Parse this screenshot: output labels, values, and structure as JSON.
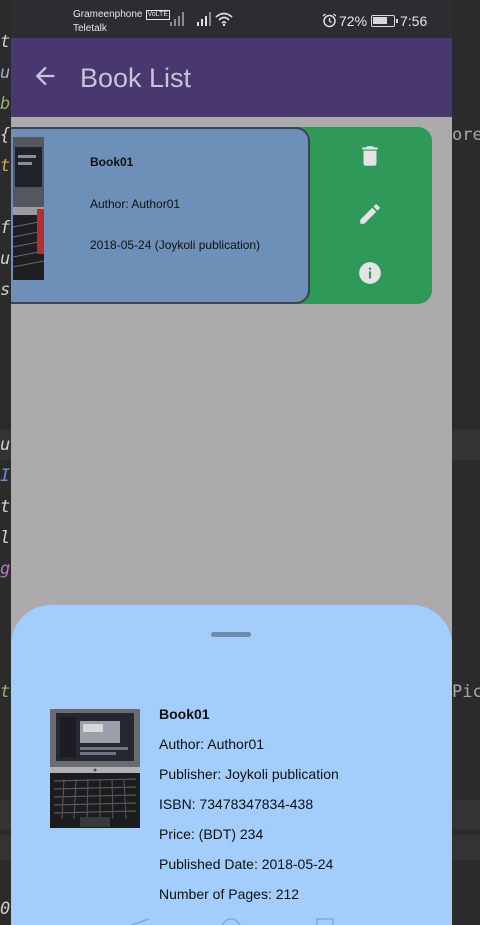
{
  "ide": {
    "left_chars": [
      "t",
      "u",
      "b",
      "{",
      "t",
      "f",
      "u",
      "s",
      "u",
      "I",
      "t",
      "l",
      "g",
      "t",
      "0"
    ],
    "right_words": [
      "ore",
      "Pic"
    ]
  },
  "status_bar": {
    "carrier1": "Grameenphone",
    "volte": "VoLTE",
    "carrier2": "Teletalk",
    "battery_text": "72%",
    "battery_level": 0.72,
    "time": "7:56",
    "icons": [
      "signal-icon",
      "signal-icon",
      "wifi-icon",
      "alarm-icon",
      "battery-charging-icon"
    ]
  },
  "app_bar": {
    "title": "Book List",
    "back_icon": "arrow-back-icon"
  },
  "book_card": {
    "title": "Book01",
    "author": "Author: Author01",
    "date_line": "2018-05-24 (Joykoli publication)",
    "actions": [
      {
        "icon": "delete-icon"
      },
      {
        "icon": "edit-icon"
      },
      {
        "icon": "info-icon"
      }
    ],
    "colors": {
      "card": "#6d8fb8",
      "actions": "#2f995a"
    }
  },
  "details_sheet": {
    "title": "Book01",
    "author": "Author: Author01",
    "publisher": "Publisher: Joykoli publication",
    "isbn": "ISBN: 73478347834-438",
    "price": "Price: (BDT) 234",
    "published_date": "Published Date: 2018-05-24",
    "pages": "Number of Pages: 212",
    "background": "#a3cdfa"
  },
  "colors": {
    "app_bar": "#48386f",
    "scrim": "#adaaad",
    "status_bar": "#2e2c30"
  }
}
